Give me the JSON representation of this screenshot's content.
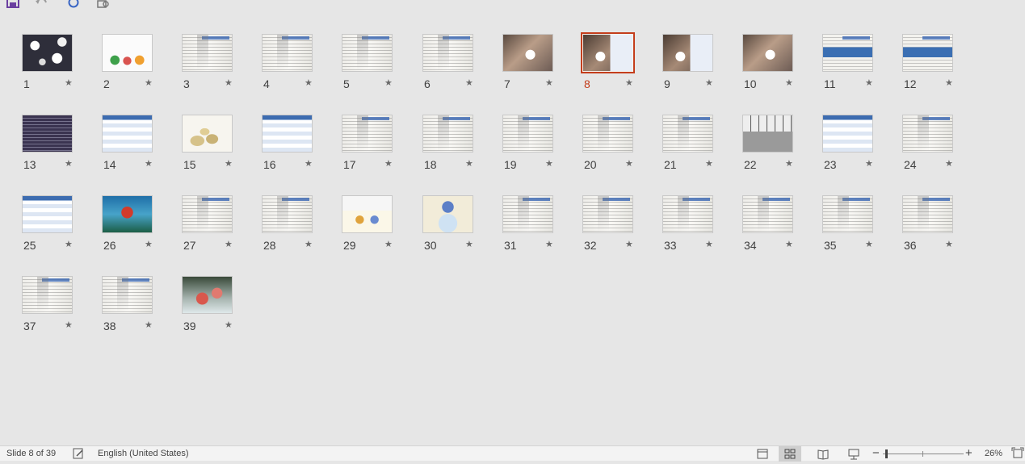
{
  "toolbar": {
    "save": "save-icon",
    "undo": "undo-icon",
    "redo": "redo-icon",
    "present": "present-from-start-icon"
  },
  "slides": [
    {
      "number": "1",
      "style": "t-flowers"
    },
    {
      "number": "2",
      "style": "t-people"
    },
    {
      "number": "3",
      "style": "t-doc"
    },
    {
      "number": "4",
      "style": "t-doc"
    },
    {
      "number": "5",
      "style": "t-doc"
    },
    {
      "number": "6",
      "style": "t-doc"
    },
    {
      "number": "7",
      "style": "t-puzzle"
    },
    {
      "number": "8",
      "style": "t-puzzle2",
      "selected": true
    },
    {
      "number": "9",
      "style": "t-puzzle2"
    },
    {
      "number": "10",
      "style": "t-puzzle"
    },
    {
      "number": "11",
      "style": "t-blue"
    },
    {
      "number": "12",
      "style": "t-blue"
    },
    {
      "number": "13",
      "style": "t-dark"
    },
    {
      "number": "14",
      "style": "t-table"
    },
    {
      "number": "15",
      "style": "t-coins"
    },
    {
      "number": "16",
      "style": "t-table"
    },
    {
      "number": "17",
      "style": "t-doc"
    },
    {
      "number": "18",
      "style": "t-doc"
    },
    {
      "number": "19",
      "style": "t-doc"
    },
    {
      "number": "20",
      "style": "t-doc"
    },
    {
      "number": "21",
      "style": "t-doc"
    },
    {
      "number": "22",
      "style": "t-gray"
    },
    {
      "number": "23",
      "style": "t-table"
    },
    {
      "number": "24",
      "style": "t-doc"
    },
    {
      "number": "25",
      "style": "t-table"
    },
    {
      "number": "26",
      "style": "t-question"
    },
    {
      "number": "27",
      "style": "t-doc"
    },
    {
      "number": "28",
      "style": "t-doc"
    },
    {
      "number": "29",
      "style": "t-cartoon"
    },
    {
      "number": "30",
      "style": "t-grads"
    },
    {
      "number": "31",
      "style": "t-doc"
    },
    {
      "number": "32",
      "style": "t-doc"
    },
    {
      "number": "33",
      "style": "t-doc"
    },
    {
      "number": "34",
      "style": "t-doc"
    },
    {
      "number": "35",
      "style": "t-doc"
    },
    {
      "number": "36",
      "style": "t-doc"
    },
    {
      "number": "37",
      "style": "t-doc"
    },
    {
      "number": "38",
      "style": "t-doc"
    },
    {
      "number": "39",
      "style": "t-roses"
    }
  ],
  "star_glyph": "★",
  "selected_color": "#c43e1c",
  "status": {
    "slide_info": "Slide 8 of 39",
    "language": "English (United States)",
    "zoom": "26%",
    "zoom_out": "−",
    "zoom_in": "+"
  }
}
